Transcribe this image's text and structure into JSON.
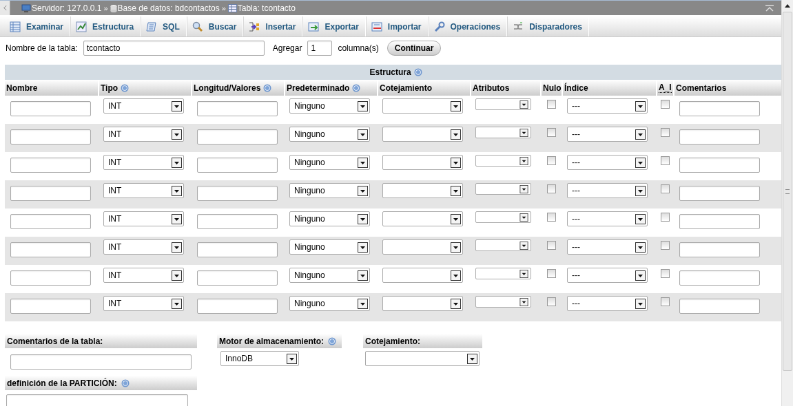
{
  "breadcrumb": [
    {
      "kind": "server",
      "label": "Servidor: 127.0.0.1"
    },
    {
      "kind": "database",
      "label": "Base de datos: bdcontactos"
    },
    {
      "kind": "table",
      "label": "Tabla: tcontacto"
    }
  ],
  "separator": "»",
  "tabs": [
    {
      "kind": "browse",
      "label": "Examinar"
    },
    {
      "kind": "structure",
      "label": "Estructura"
    },
    {
      "kind": "sql",
      "label": "SQL"
    },
    {
      "kind": "search",
      "label": "Buscar"
    },
    {
      "kind": "insert",
      "label": "Insertar"
    },
    {
      "kind": "export",
      "label": "Exportar"
    },
    {
      "kind": "import",
      "label": "Importar"
    },
    {
      "kind": "operations",
      "label": "Operaciones"
    },
    {
      "kind": "triggers",
      "label": "Disparadores"
    }
  ],
  "form": {
    "table_name_label": "Nombre de la tabla:",
    "table_name": "tcontacto",
    "add_label": "Agregar",
    "add_count": "1",
    "columns_label": "columna(s)",
    "continue_button": "Continuar"
  },
  "structure": {
    "title": "Estructura",
    "columns": [
      {
        "label": "Nombre",
        "help": false
      },
      {
        "label": "Tipo",
        "help": true
      },
      {
        "label": "Longitud/Valores",
        "help": true
      },
      {
        "label": "Predeterminado",
        "help": true
      },
      {
        "label": "Cotejamiento",
        "help": false
      },
      {
        "label": "Atributos",
        "help": false
      },
      {
        "label": "Nulo",
        "help": false
      },
      {
        "label": "Índice",
        "help": false
      },
      {
        "label": "A_I",
        "help": false
      },
      {
        "label": "Comentarios",
        "help": false
      }
    ],
    "rows": [
      {
        "type": "INT",
        "default": "Ninguno",
        "null": false,
        "index": "---",
        "ai": false
      },
      {
        "type": "INT",
        "default": "Ninguno",
        "null": false,
        "index": "---",
        "ai": false
      },
      {
        "type": "INT",
        "default": "Ninguno",
        "null": false,
        "index": "---",
        "ai": false
      },
      {
        "type": "INT",
        "default": "Ninguno",
        "null": false,
        "index": "---",
        "ai": false
      },
      {
        "type": "INT",
        "default": "Ninguno",
        "null": false,
        "index": "---",
        "ai": false
      },
      {
        "type": "INT",
        "default": "Ninguno",
        "null": false,
        "index": "---",
        "ai": false
      },
      {
        "type": "INT",
        "default": "Ninguno",
        "null": false,
        "index": "---",
        "ai": false
      },
      {
        "type": "INT",
        "default": "Ninguno",
        "null": false,
        "index": "---",
        "ai": false
      }
    ]
  },
  "table_comments": {
    "label": "Comentarios de la tabla:"
  },
  "storage_engine": {
    "label": "Motor de almacenamiento:",
    "value": "InnoDB"
  },
  "collation": {
    "label": "Cotejamiento:"
  },
  "partition": {
    "label": "definición de la PARTICIÓN:"
  }
}
